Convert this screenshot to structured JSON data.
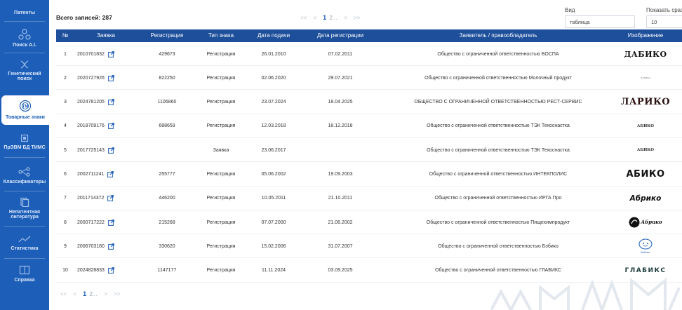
{
  "sidebar": {
    "items": [
      {
        "label": "Патенты",
        "icon": "patents-icon"
      },
      {
        "label": "Поиск А.І.",
        "icon": "ai-search-icon"
      },
      {
        "label": "Генетический поиск",
        "icon": "genetic-search-icon"
      },
      {
        "label": "Товарные знаки",
        "icon": "trademark-icon",
        "active": true
      },
      {
        "label": "ПрЭВМ БД ТИМС",
        "icon": "software-db-icon"
      },
      {
        "label": "Классификаторы",
        "icon": "classifiers-icon"
      },
      {
        "label": "Непатентная литература",
        "icon": "literature-icon"
      },
      {
        "label": "Статистика",
        "icon": "statistics-icon"
      },
      {
        "label": "Справка",
        "icon": "help-icon"
      }
    ]
  },
  "toolbar": {
    "total_label": "Всего записей: 287",
    "view_label": "Вид",
    "view_value": "таблица",
    "show_label": "Показать сраз",
    "show_value": "10"
  },
  "pagination": {
    "first": "<<",
    "prev": "<",
    "current": "1",
    "next_page": "2...",
    "next": ">",
    "last": ">>"
  },
  "table": {
    "columns": [
      "№",
      "Заявка",
      "Регистрация",
      "Тип знака",
      "Дата подачи",
      "Дата регистрации",
      "Заявитель / правообладатель",
      "Изображение"
    ],
    "rows": [
      {
        "n": "1",
        "app": "2010701832",
        "reg": "429673",
        "type": "Регистрация",
        "filed": "26.01.2010",
        "regdate": "07.02.2011",
        "owner": "Общество с ограниченной ответственностью БОСПА",
        "logo": "ДАБИКО"
      },
      {
        "n": "2",
        "app": "2020727926",
        "reg": "822250",
        "type": "Регистрация",
        "filed": "02.06.2020",
        "regdate": "29.07.2021",
        "owner": "Общество с ограниченной ответственностью Молочный продукт",
        "logo": "ДАБИКО"
      },
      {
        "n": "3",
        "app": "2024781205",
        "reg": "1106860",
        "type": "Регистрация",
        "filed": "23.07.2024",
        "regdate": "18.04.2025",
        "owner": "ОБЩЕСТВО С ОГРАНИЧЕННОЙ ОТВЕТСТВЕННОСТЬЮ РЕСТ-СЕРВИС",
        "logo": "ЛАРИКО"
      },
      {
        "n": "4",
        "app": "2018709176",
        "reg": "688659",
        "type": "Регистрация",
        "filed": "12.03.2018",
        "regdate": "18.12.2018",
        "owner": "Общество с ограниченной ответственностью ТЭК Техоснастка",
        "logo": "АБИКО"
      },
      {
        "n": "5",
        "app": "2017725143",
        "reg": "",
        "type": "Заявка",
        "filed": "23.06.2017",
        "regdate": "",
        "owner": "Общество с ограниченной ответственностью ТЭК Техоснастка",
        "logo": "АБИКО"
      },
      {
        "n": "6",
        "app": "2002711241",
        "reg": "255777",
        "type": "Регистрация",
        "filed": "05.06.2002",
        "regdate": "19.09.2003",
        "owner": "Общество с ограниченной ответственностью ИНТЕКПОЛИС",
        "logo": "АБИКО"
      },
      {
        "n": "7",
        "app": "2011714372",
        "reg": "446200",
        "type": "Регистрация",
        "filed": "10.05.2011",
        "regdate": "21.10.2011",
        "owner": "Общество с ограниченной ответственностью ИРГА Про",
        "logo": "Абрико"
      },
      {
        "n": "8",
        "app": "2000717222",
        "reg": "215268",
        "type": "Регистрация",
        "filed": "07.07.2000",
        "regdate": "21.06.2002",
        "owner": "Общество с ограниченной ответственностью Пищехимпродукт",
        "logo": "Абрико"
      },
      {
        "n": "9",
        "app": "2006703180",
        "reg": "330620",
        "type": "Регистрация",
        "filed": "15.02.2006",
        "regdate": "31.07.2007",
        "owner": "Общество с ограниченной ответственностью Бэбико",
        "logo": "Бэбико"
      },
      {
        "n": "10",
        "app": "2024828833",
        "reg": "1147177",
        "type": "Регистрация",
        "filed": "11.11.2024",
        "regdate": "03.09.2025",
        "owner": "Общество с ограниченной ответственностью ГЛАБИКС",
        "logo": "ГЛАБИКС"
      }
    ]
  },
  "colors": {
    "sidebar": "#1d5fb8",
    "header": "#1d4f9b",
    "accent": "#1d5fb8",
    "link": "#1d5fb8"
  }
}
